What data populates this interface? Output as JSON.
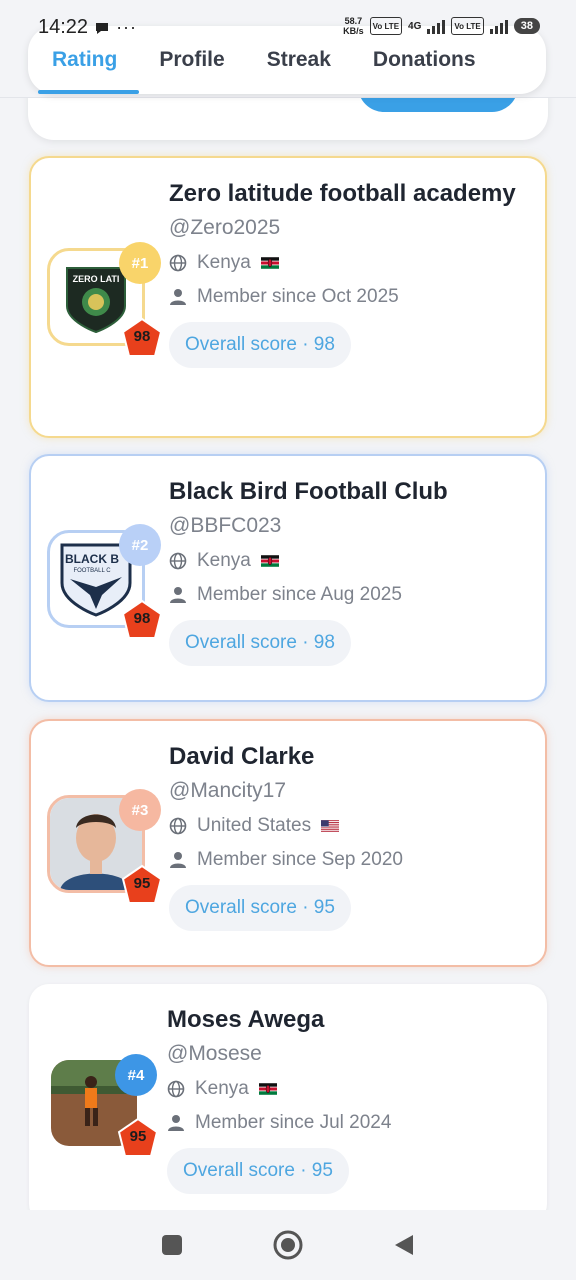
{
  "status_bar": {
    "time": "14:22",
    "speed_value": "58.7",
    "speed_unit": "KB/s",
    "network": "4G",
    "volte": "Vo LTE",
    "battery": "38"
  },
  "tabs": [
    {
      "label": "Rating",
      "active": true
    },
    {
      "label": "Profile",
      "active": false
    },
    {
      "label": "Streak",
      "active": false
    },
    {
      "label": "Donations",
      "active": false
    }
  ],
  "leaderboard": [
    {
      "rank": "#1",
      "name": "Zero latitude football academy",
      "handle": "@Zero2025",
      "country": "Kenya",
      "flag": "kenya-flag",
      "member_since": "Member since Oct 2025",
      "score": "98",
      "overall_score": "Overall score · 98",
      "avatar_text": "ZERO LATI",
      "avatar": "zero-latitude-logo"
    },
    {
      "rank": "#2",
      "name": "Black Bird Football Club",
      "handle": "@BBFC023",
      "country": "Kenya",
      "flag": "kenya-flag",
      "member_since": "Member since Aug 2025",
      "score": "98",
      "overall_score": "Overall score · 98",
      "avatar_text": "BLACK B",
      "avatar_subtext": "FOOTBALL C",
      "avatar": "black-bird-logo"
    },
    {
      "rank": "#3",
      "name": "David Clarke",
      "handle": "@Mancity17",
      "country": "United States",
      "flag": "usa-flag",
      "member_since": "Member since Sep 2020",
      "score": "95",
      "overall_score": "Overall score · 95",
      "avatar": "person-photo"
    },
    {
      "rank": "#4",
      "name": "Moses Awega",
      "handle": "@Mosese",
      "country": "Kenya",
      "flag": "kenya-flag",
      "member_since": "Member since Jul 2024",
      "score": "95",
      "overall_score": "Overall score · 95",
      "avatar": "player-photo"
    }
  ],
  "colors": {
    "accent": "#3aa0e6",
    "gold": "#f5d98e",
    "silver": "#b7cff3",
    "bronze": "#f3bda6",
    "score_red": "#e8401c"
  },
  "icons": [
    "globe-icon",
    "person-icon",
    "stop-icon",
    "home-icon",
    "back-icon",
    "message-icon"
  ]
}
